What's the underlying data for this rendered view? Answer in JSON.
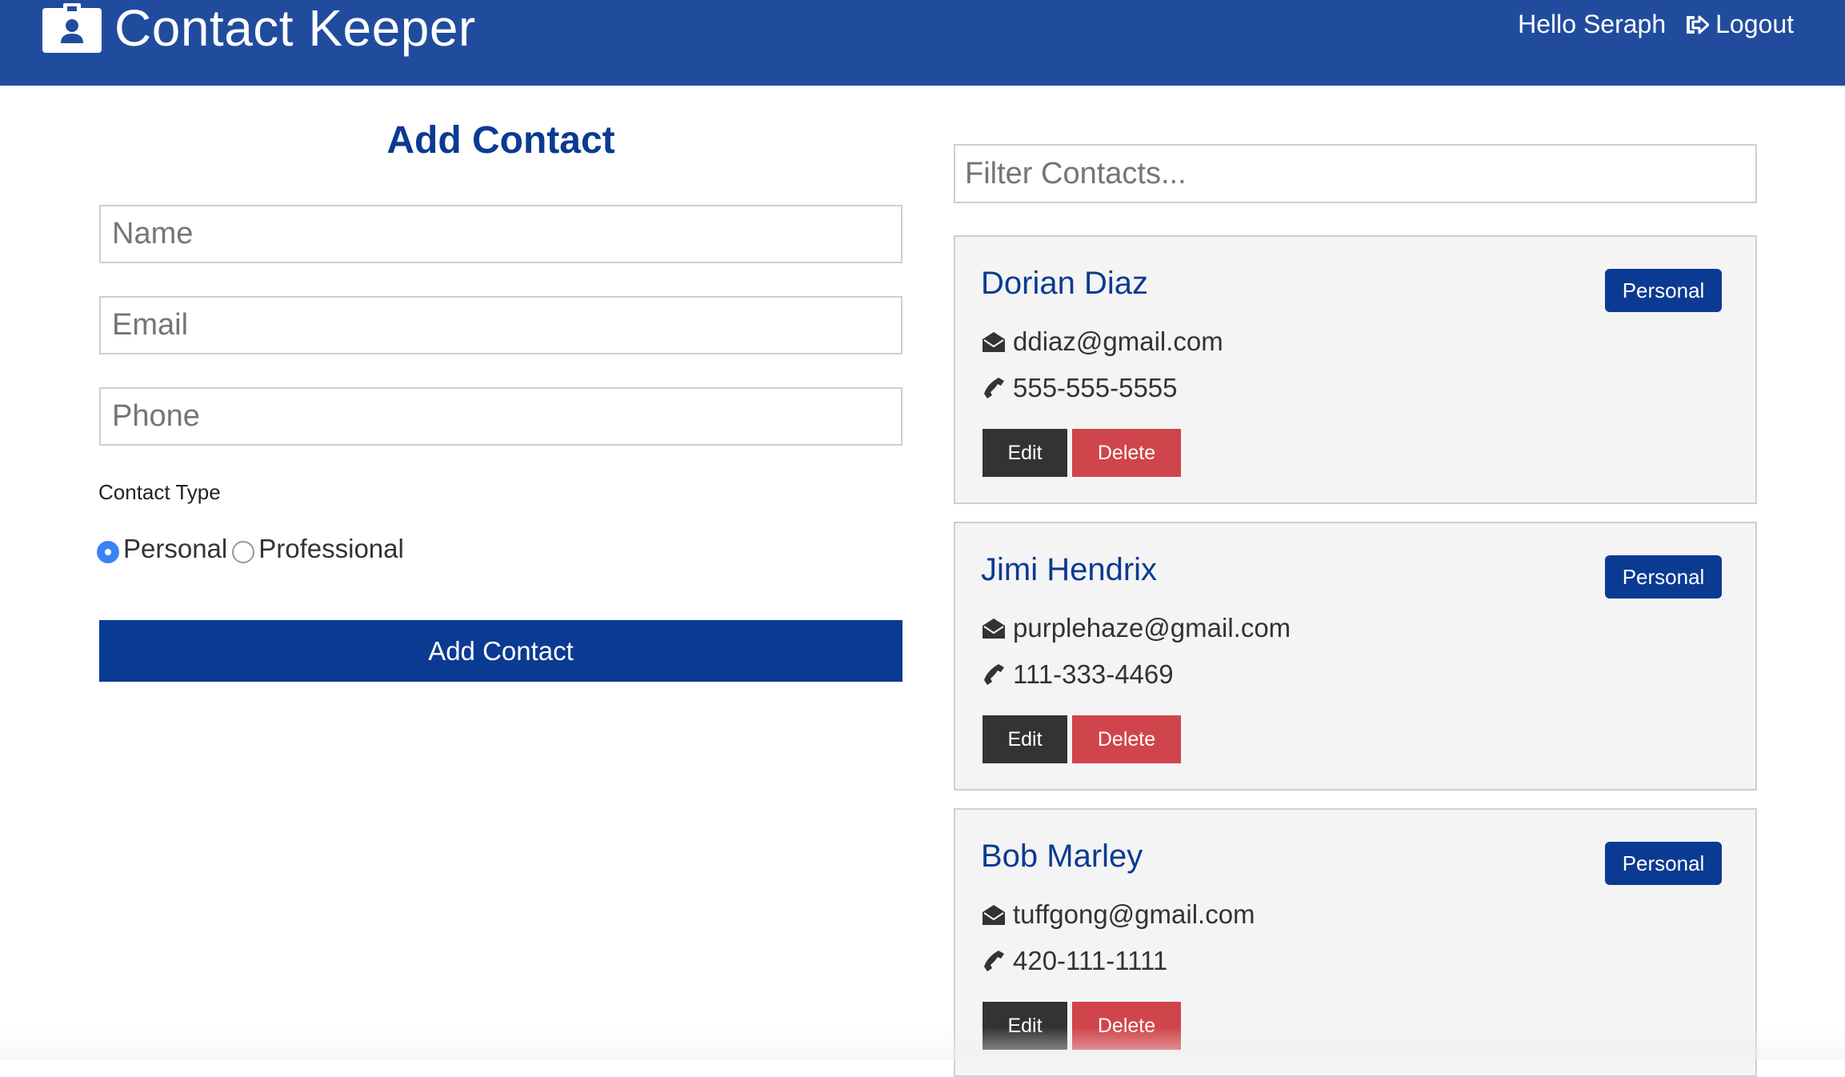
{
  "navbar": {
    "title": "Contact Keeper",
    "brand_icon": "id-badge-icon",
    "greeting": "Hello Seraph",
    "logout_label": "Logout",
    "logout_icon": "sign-out-icon",
    "background_color": "#214c9e"
  },
  "form": {
    "heading": "Add Contact",
    "name_placeholder": "Name",
    "email_placeholder": "Email",
    "phone_placeholder": "Phone",
    "contact_type_label": "Contact Type",
    "options": [
      {
        "label": "Personal",
        "checked": true
      },
      {
        "label": "Professional",
        "checked": false
      }
    ],
    "submit_label": "Add Contact",
    "primary_color": "#0b3a92"
  },
  "filter": {
    "placeholder": "Filter Contacts..."
  },
  "contacts": [
    {
      "name": "Dorian Diaz",
      "email": "ddiaz@gmail.com",
      "phone": "555-555-5555",
      "type": "Personal",
      "edit_label": "Edit",
      "delete_label": "Delete"
    },
    {
      "name": "Jimi Hendrix",
      "email": "purplehaze@gmail.com",
      "phone": "111-333-4469",
      "type": "Personal",
      "edit_label": "Edit",
      "delete_label": "Delete"
    },
    {
      "name": "Bob Marley",
      "email": "tuffgong@gmail.com",
      "phone": "420-111-1111",
      "type": "Personal",
      "edit_label": "Edit",
      "delete_label": "Delete"
    }
  ],
  "icons": {
    "email": "envelope-open-icon",
    "phone": "phone-icon"
  },
  "colors": {
    "danger": "#d0454b",
    "dark": "#333333",
    "card_bg": "#f4f4f4"
  }
}
